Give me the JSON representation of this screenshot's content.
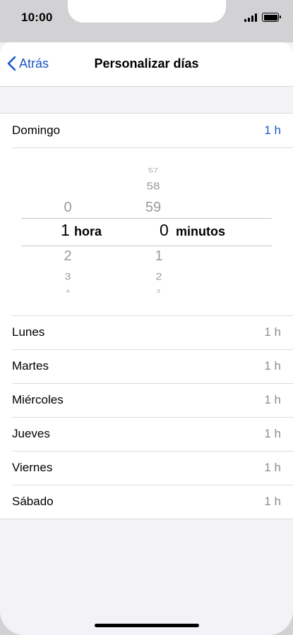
{
  "status": {
    "time": "10:00"
  },
  "nav": {
    "back_label": "Atrás",
    "title": "Personalizar días"
  },
  "sunday": {
    "label": "Domingo",
    "value": "1 h"
  },
  "picker": {
    "hours_above": [
      "0"
    ],
    "hours_selected": "1",
    "hours_unit": "hora",
    "hours_below": [
      "2",
      "3",
      "4"
    ],
    "minutes_above": [
      "57",
      "58",
      "59"
    ],
    "minutes_selected": "0",
    "minutes_unit": "minutos",
    "minutes_below": [
      "1",
      "2",
      "3"
    ]
  },
  "days": [
    {
      "label": "Lunes",
      "value": "1 h"
    },
    {
      "label": "Martes",
      "value": "1 h"
    },
    {
      "label": "Miércoles",
      "value": "1 h"
    },
    {
      "label": "Jueves",
      "value": "1 h"
    },
    {
      "label": "Viernes",
      "value": "1 h"
    },
    {
      "label": "Sábado",
      "value": "1 h"
    }
  ],
  "colors": {
    "accent": "#1a56c9",
    "secondary_text": "#8e8e93",
    "background": "#f2f2f7"
  }
}
